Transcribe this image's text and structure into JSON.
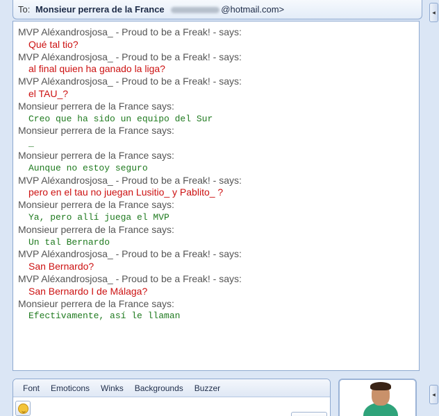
{
  "header": {
    "to_label": "To:",
    "contact_name": "Monsieur perrera de la France",
    "email_domain": "@hotmail.com>",
    "chevron": "◂"
  },
  "conversation": [
    {
      "speaker": "MVP Aléxandrosjosa_ - Proud to be a Freak! - says:",
      "text": "Qué tal tio?",
      "color": "red"
    },
    {
      "speaker": "MVP Aléxandrosjosa_ - Proud to be a Freak! - says:",
      "text": "al final quien ha ganado la liga?",
      "color": "red"
    },
    {
      "speaker": "MVP Aléxandrosjosa_ - Proud to be a Freak! - says:",
      "text": "el TAU_?",
      "color": "red"
    },
    {
      "speaker": "Monsieur perrera de la France says:",
      "text": "Creo que ha sido un equipo del Sur",
      "color": "green"
    },
    {
      "speaker": "Monsieur perrera de la France says:",
      "text": "_",
      "color": "green"
    },
    {
      "speaker": "Monsieur perrera de la France says:",
      "text": "Aunque no estoy seguro",
      "color": "green"
    },
    {
      "speaker": "MVP Aléxandrosjosa_ - Proud to be a Freak! - says:",
      "text": "pero en el tau no juegan Lusitio_ y Pablito_ ?",
      "color": "red"
    },
    {
      "speaker": "Monsieur perrera de la France says:",
      "text": "Ya, pero allí juega el MVP",
      "color": "green"
    },
    {
      "speaker": "Monsieur perrera de la France says:",
      "text": "Un tal Bernardo",
      "color": "green"
    },
    {
      "speaker": "MVP Aléxandrosjosa_ - Proud to be a Freak! - says:",
      "text": "San Bernardo?",
      "color": "red"
    },
    {
      "speaker": "MVP Aléxandrosjosa_ - Proud to be a Freak! - says:",
      "text": "San Bernardo I de Málaga?",
      "color": "red"
    },
    {
      "speaker": "Monsieur perrera de la France says:",
      "text": "Efectivamente, así le llaman",
      "color": "green"
    }
  ],
  "toolbar": {
    "font": "Font",
    "emoticons": "Emoticons",
    "winks": "Winks",
    "backgrounds": "Backgrounds",
    "buzzer": "Buzzer"
  },
  "icons": {
    "emoticon": "smiley-icon",
    "expand": "chevron-left-icon",
    "avatar": "contact-display-picture"
  },
  "colors": {
    "red_text": "#cc1111",
    "green_text": "#1f7a1f",
    "says_text": "#555555",
    "border": "#8ea9d0",
    "background": "#dbe6f5"
  }
}
